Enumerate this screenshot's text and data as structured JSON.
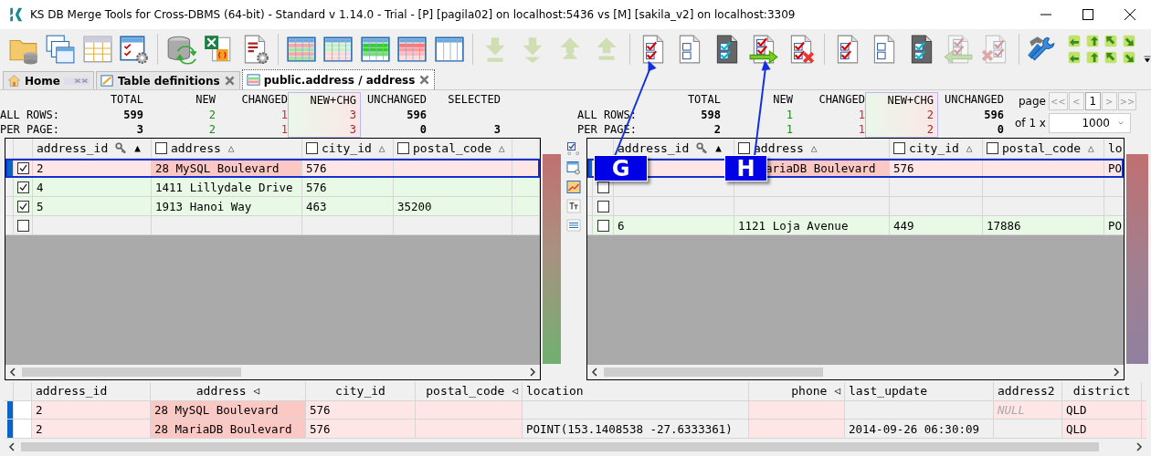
{
  "window": {
    "title": "KS DB Merge Tools for Cross-DBMS (64-bit) - Standard v 1.14.0 - Trial - [P] [pagila02] on localhost:5436 vs [M] [sakila_v2] on localhost:3309"
  },
  "toolbar": [
    {
      "disabled": false
    },
    {
      "disabled": false
    },
    {
      "disabled": false
    },
    {
      "disabled": false
    },
    {
      "disabled": false
    },
    {
      "disabled": false
    },
    {
      "disabled": false
    },
    {
      "disabled": false
    },
    {
      "disabled": false
    },
    {
      "disabled": false
    },
    {
      "disabled": false
    },
    {
      "disabled": false
    },
    {
      "disabled": true
    },
    {
      "disabled": true
    },
    {
      "disabled": true
    },
    {
      "disabled": true
    },
    {
      "disabled": false
    },
    {
      "disabled": false
    },
    {
      "disabled": false
    },
    {
      "disabled": false
    },
    {
      "disabled": false
    },
    {
      "disabled": false
    },
    {
      "disabled": false
    },
    {
      "disabled": false
    },
    {
      "disabled": true
    },
    {
      "disabled": true
    },
    {
      "disabled": false
    },
    {
      "disabled": false
    },
    {
      "disabled": false
    },
    {
      "disabled": false
    },
    {
      "disabled": false
    },
    {
      "disabled": false
    },
    {
      "disabled": false
    },
    {
      "disabled": false
    },
    {
      "disabled": false
    }
  ],
  "tabs": [
    {
      "label": "Home",
      "selected": false,
      "closable": false
    },
    {
      "label": "Table definitions",
      "selected": false,
      "closable": true
    },
    {
      "label": "public.address / address",
      "selected": true,
      "closable": true
    }
  ],
  "left_stats": {
    "headers": [
      "TOTAL",
      "NEW",
      "CHANGED",
      "NEW+CHG",
      "UNCHANGED",
      "SELECTED"
    ],
    "rows": [
      {
        "label": "ALL ROWS:",
        "total": "599",
        "new": "2",
        "changed": "1",
        "new_chg": "3",
        "unchanged": "596"
      },
      {
        "label": "PER PAGE:",
        "total": "3",
        "new": "2",
        "changed": "1",
        "new_chg": "3",
        "unchanged": "0",
        "selected": "3"
      }
    ]
  },
  "right_stats": {
    "headers": [
      "TOTAL",
      "NEW",
      "CHANGED",
      "NEW+CHG",
      "UNCHANGED"
    ],
    "rows": [
      {
        "label": "ALL ROWS:",
        "total": "598",
        "new": "1",
        "changed": "1",
        "new_chg": "2",
        "unchanged": "596"
      },
      {
        "label": "PER PAGE:",
        "total": "2",
        "new": "1",
        "changed": "1",
        "new_chg": "2",
        "unchanged": "0"
      }
    ]
  },
  "pager": {
    "label": "page",
    "buttons": [
      "<<",
      "<",
      "1",
      ">",
      ">>"
    ],
    "of": "of 1 x",
    "page_size": "1000"
  },
  "left_grid": {
    "columns": [
      {
        "label": "address_id",
        "key": true,
        "sort": "▲"
      },
      {
        "label": "address",
        "checked": false,
        "key": false,
        "sort": "△"
      },
      {
        "label": "city_id",
        "checked": false,
        "key": false,
        "sort": "△"
      },
      {
        "label": "postal_code",
        "checked": false,
        "key": false,
        "sort": "△"
      }
    ],
    "rows": [
      {
        "kind": "changed",
        "checked": true,
        "selected": true,
        "cells": [
          {
            "text": "2",
            "differs": false
          },
          {
            "text": "28 MySQL Boulevard",
            "differs": true
          },
          {
            "text": "576",
            "differs": false
          },
          {
            "differs": false
          }
        ]
      },
      {
        "kind": "new",
        "checked": true,
        "selected": false,
        "cells": [
          {
            "text": "4",
            "differs": false
          },
          {
            "text": "1411 Lillydale Drive",
            "differs": false
          },
          {
            "text": "576",
            "differs": false
          },
          {
            "differs": false
          }
        ]
      },
      {
        "kind": "new",
        "checked": true,
        "selected": false,
        "cells": [
          {
            "text": "5",
            "differs": false
          },
          {
            "text": "1913 Hanoi Way",
            "differs": false
          },
          {
            "text": "463",
            "differs": false
          },
          {
            "text": "35200",
            "differs": false
          }
        ]
      },
      {
        "kind": "empty",
        "checked": false,
        "selected": false,
        "cells": [
          {
            "differs": false
          },
          {
            "differs": false
          },
          {
            "differs": false
          },
          {
            "differs": false
          }
        ]
      }
    ]
  },
  "right_grid": {
    "columns": [
      {
        "label": "address_id",
        "key": true,
        "sort": "▲"
      },
      {
        "label": "address",
        "checked": false,
        "key": false,
        "sort": "△"
      },
      {
        "label": "city_id",
        "checked": false,
        "key": false,
        "sort": "△"
      },
      {
        "label": "postal_code",
        "checked": false,
        "key": false,
        "sort": "△"
      },
      {
        "label": "lo"
      }
    ],
    "rows": [
      {
        "kind": "changed",
        "selected": true,
        "cells": [
          {
            "text": ""
          },
          {
            "text": "ariaDB Boulevard",
            "differs": true
          },
          {
            "text": "576",
            "differs": false
          },
          {
            "differs": false
          },
          {
            "text": "PO",
            "differs": false
          }
        ]
      },
      {
        "kind": "empty",
        "checked": false,
        "selected": false,
        "cells": [
          {
            "differs": false
          },
          {
            "differs": false
          },
          {
            "differs": false
          },
          {
            "differs": false
          },
          {
            "differs": false
          }
        ]
      },
      {
        "kind": "empty",
        "checked": false,
        "selected": false,
        "cells": [
          {
            "differs": false
          },
          {
            "differs": false
          },
          {
            "differs": false
          },
          {
            "differs": false
          },
          {
            "differs": false
          }
        ]
      },
      {
        "kind": "new",
        "checked": false,
        "selected": false,
        "cells": [
          {
            "text": "6",
            "differs": false
          },
          {
            "text": "1121 Loja Avenue",
            "differs": false
          },
          {
            "text": "449",
            "differs": false
          },
          {
            "text": "17886",
            "differs": false
          },
          {
            "text": "PO",
            "differs": false
          }
        ]
      }
    ]
  },
  "detail_grid": {
    "columns": [
      {
        "label": "address_id"
      },
      {
        "label": "address",
        "sort": "◁"
      },
      {
        "label": "city_id"
      },
      {
        "label": "postal_code",
        "sort": "◁"
      },
      {
        "label": "location"
      },
      {
        "label": "phone",
        "sort": "◁"
      },
      {
        "label": "last_update"
      },
      {
        "label": "address2"
      },
      {
        "label": "district"
      }
    ],
    "rows": [
      {
        "selected": true,
        "cells": [
          {
            "text": "2",
            "differs": false,
            "tinted": true
          },
          {
            "text": "28 MySQL Boulevard",
            "differs": true
          },
          {
            "text": "576",
            "differs": false,
            "tinted": true
          },
          {
            "differs": false,
            "tinted": true
          },
          {
            "differs": false,
            "tinted": false
          },
          {
            "differs": false,
            "tinted": true
          },
          {
            "differs": false,
            "tinted": false
          },
          {
            "text": "NULL",
            "null": true,
            "differs": false,
            "tinted": true
          },
          {
            "text": "QLD",
            "differs": false,
            "tinted": true
          }
        ]
      },
      {
        "selected": true,
        "cells": [
          {
            "text": "2",
            "differs": false,
            "tinted": true
          },
          {
            "text": "28 MariaDB Boulevard",
            "differs": true
          },
          {
            "text": "576",
            "differs": false,
            "tinted": true
          },
          {
            "differs": false,
            "tinted": true
          },
          {
            "text": "POINT(153.1408538 -27.6333361)",
            "differs": false,
            "tinted": false
          },
          {
            "differs": false,
            "tinted": true
          },
          {
            "text": "2014-09-26 06:30:09",
            "differs": false,
            "tinted": false
          },
          {
            "differs": false,
            "tinted": false
          },
          {
            "text": "QLD",
            "differs": false,
            "tinted": true
          }
        ]
      }
    ]
  },
  "annotations": [
    {
      "label": "G"
    },
    {
      "label": "H"
    }
  ]
}
